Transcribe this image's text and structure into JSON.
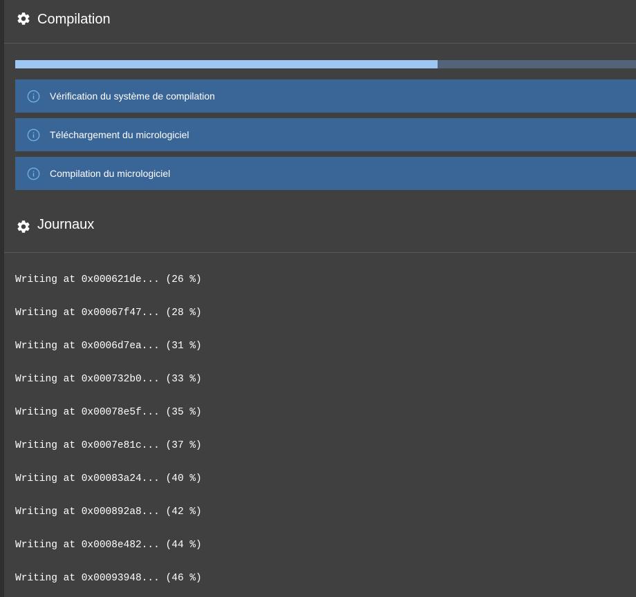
{
  "compilation": {
    "title": "Compilation",
    "icon": "gear-icon",
    "progress": 0.68,
    "steps": [
      {
        "label": "Vérification du système de compilation",
        "icon": "info-icon"
      },
      {
        "label": "Téléchargement du micrologiciel",
        "icon": "info-icon"
      },
      {
        "label": "Compilation du micrologiciel",
        "icon": "info-icon"
      }
    ]
  },
  "logs": {
    "title": "Journaux",
    "icon": "gear-icon",
    "lines": [
      "Writing at 0x000621de... (26 %)",
      "Writing at 0x00067f47... (28 %)",
      "Writing at 0x0006d7ea... (31 %)",
      "Writing at 0x000732b0... (33 %)",
      "Writing at 0x00078e5f... (35 %)",
      "Writing at 0x0007e81c... (37 %)",
      "Writing at 0x00083a24... (40 %)",
      "Writing at 0x000892a8... (42 %)",
      "Writing at 0x0008e482... (44 %)",
      "Writing at 0x00093948... (46 %)"
    ]
  },
  "colors": {
    "background": "#404040",
    "step_background": "#3a6597",
    "progress_fill": "#9ec6f3",
    "progress_track": "#52637a",
    "info_icon": "#6fb2ea"
  }
}
